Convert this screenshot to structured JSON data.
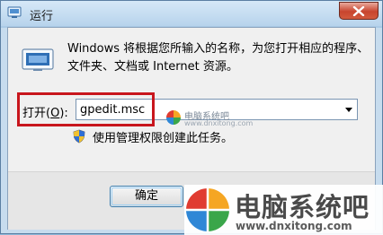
{
  "window": {
    "title": "运行",
    "close_icon": "close-icon"
  },
  "dialog": {
    "description_line1": "Windows 将根据您所输入的名称，为您打开相应的程序、",
    "description_line2": "文件夹、文档或 Internet 资源。",
    "open_label": "打开(",
    "open_label_hotkey": "O",
    "open_label_suffix": "):",
    "command_value": "gpedit.msc",
    "admin_note": "使用管理权限创建此任务。",
    "ok_label": "确定"
  },
  "watermark_small": {
    "name": "电脑系统吧",
    "url": "www.dnxitong.com"
  },
  "watermark_big": {
    "name": "电脑系统吧",
    "url": "www.dnxitong.com"
  },
  "colors": {
    "highlight": "#c8161d",
    "title_bar": "#b7d3ec",
    "close_button": "#c8452e"
  }
}
